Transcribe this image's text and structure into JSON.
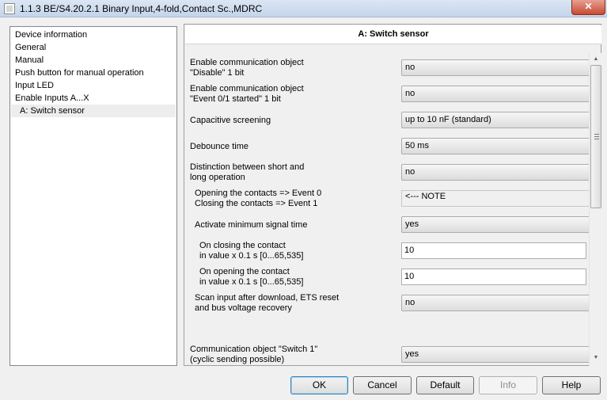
{
  "window": {
    "title": "1.1.3 BE/S4.20.2.1 Binary Input,4-fold,Contact Sc.,MDRC",
    "close_label": "✕"
  },
  "nav": {
    "items": [
      {
        "label": "Device information"
      },
      {
        "label": "General"
      },
      {
        "label": "Manual"
      },
      {
        "label": "Push button for manual operation"
      },
      {
        "label": "Input LED"
      },
      {
        "label": "Enable Inputs A...X"
      },
      {
        "label": "A: Switch sensor",
        "selected": true
      }
    ]
  },
  "panel": {
    "title": "A: Switch sensor",
    "params": [
      {
        "label": "Enable communication object\n\"Disable\" 1 bit",
        "value": "no"
      },
      {
        "label": "Enable communication object\n\"Event 0/1 started\" 1 bit",
        "value": "no"
      },
      {
        "label": "Capacitive screening",
        "value": "up to 10 nF (standard)"
      },
      {
        "label": "Debounce time",
        "value": "50 ms"
      },
      {
        "label": "Distinction between short and\nlong operation",
        "value": "no"
      },
      {
        "label": "Opening the contacts => Event 0\nClosing the contacts => Event 1",
        "value": "<--- NOTE"
      },
      {
        "label": "Activate minimum signal time",
        "value": "yes"
      },
      {
        "label": "On closing the contact\nin value x 0.1 s [0...65,535]",
        "value": "10"
      },
      {
        "label": "On opening the contact\nin value x 0.1 s [0...65,535]",
        "value": "10"
      },
      {
        "label": "Scan input after download, ETS reset\nand bus voltage recovery",
        "value": "no"
      },
      {
        "label": "Communication object \"Switch 1\"\n(cyclic sending possible)",
        "value": "yes"
      }
    ]
  },
  "buttons": {
    "ok": "OK",
    "cancel": "Cancel",
    "default": "Default",
    "info": "Info",
    "help": "Help"
  },
  "colors": {
    "selected_item_bg": "#ededed",
    "default_button_border": "#3c7fb1",
    "close_button": "#c74a33"
  }
}
